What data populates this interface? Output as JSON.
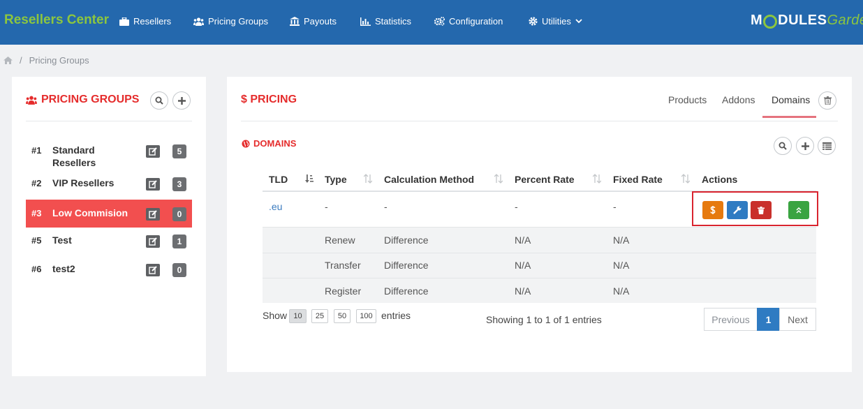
{
  "brand": "Resellers Center",
  "nav": [
    {
      "label": "Resellers",
      "icon": "briefcase-icon"
    },
    {
      "label": "Pricing Groups",
      "icon": "users-icon"
    },
    {
      "label": "Payouts",
      "icon": "bank-icon"
    },
    {
      "label": "Statistics",
      "icon": "bar-chart-icon"
    },
    {
      "label": "Configuration",
      "icon": "cogs-icon"
    },
    {
      "label": "Utilities",
      "icon": "gear-icon"
    }
  ],
  "logo": {
    "part1": "M",
    "part2": "DULES",
    "part3": "Garden"
  },
  "breadcrumb": {
    "separator": "/",
    "current": "Pricing Groups"
  },
  "pricing_groups": {
    "title": "PRICING GROUPS",
    "items": [
      {
        "num": "#1",
        "name": "Standard Resellers",
        "count": "5",
        "active": false
      },
      {
        "num": "#2",
        "name": "VIP Resellers",
        "count": "3",
        "active": false
      },
      {
        "num": "#3",
        "name": "Low Commision",
        "count": "0",
        "active": true
      },
      {
        "num": "#5",
        "name": "Test",
        "count": "1",
        "active": false
      },
      {
        "num": "#6",
        "name": "test2",
        "count": "0",
        "active": false
      }
    ]
  },
  "pricing": {
    "title": "$ PRICING",
    "tabs": [
      "Products",
      "Addons",
      "Domains"
    ],
    "active_tab": "Domains",
    "section_title": "DOMAINS"
  },
  "table": {
    "headers": [
      "TLD",
      "Type",
      "Calculation Method",
      "Percent Rate",
      "Fixed Rate",
      "Actions"
    ],
    "main_row": {
      "tld": ".eu",
      "type": "-",
      "method": "-",
      "percent": "-",
      "fixed": "-"
    },
    "sub_rows": [
      {
        "type": "Renew",
        "method": "Difference",
        "percent": "N/A",
        "fixed": "N/A"
      },
      {
        "type": "Transfer",
        "method": "Difference",
        "percent": "N/A",
        "fixed": "N/A"
      },
      {
        "type": "Register",
        "method": "Difference",
        "percent": "N/A",
        "fixed": "N/A"
      }
    ],
    "action_colors": {
      "pricing": "#e67a0f",
      "configure": "#2f7bc2",
      "delete": "#c9302c",
      "expand": "#3aa441"
    }
  },
  "footer": {
    "show": "Show",
    "lengths": [
      "10",
      "25",
      "50",
      "100"
    ],
    "entries": "entries",
    "info": "Showing 1 to 1 of 1 entries",
    "previous": "Previous",
    "page": "1",
    "next": "Next"
  }
}
